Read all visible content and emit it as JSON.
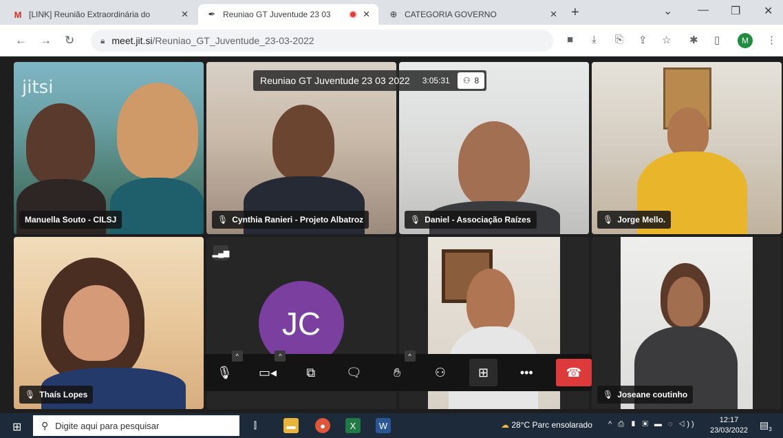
{
  "tabs": [
    {
      "title": "[LINK] Reunião Extraordinária do",
      "favicon": "gmail-icon",
      "active": false
    },
    {
      "title": "Reuniao GT Juventude 23 03",
      "favicon": "jitsi-icon",
      "active": true
    },
    {
      "title": "CATEGORIA GOVERNO",
      "favicon": "globe-icon",
      "active": false
    }
  ],
  "new_tab_symbol": "+",
  "address": {
    "host": "meet.jit.si",
    "path": "/Reuniao_GT_Juventude_23-03-2022"
  },
  "profile_initial": "M",
  "meeting": {
    "title": "Reuniao GT Juventude 23 03 2022",
    "timer": "3:05:31",
    "participant_count": "8",
    "brand": "jitsi"
  },
  "participants": [
    {
      "name": "Manuella Souto - CILSJ",
      "muted": false
    },
    {
      "name": "Cynthia Ranieri - Projeto Albatroz",
      "muted": true
    },
    {
      "name": "Daniel - Associação Raízes",
      "muted": true,
      "active_speaker": true
    },
    {
      "name": "Jorge Mello.",
      "muted": true
    },
    {
      "name": "Thaís Lopes",
      "muted": true
    },
    {
      "name": "",
      "avatar_initials": "JC",
      "avatar_color": "#7b3fa0"
    },
    {
      "name": "",
      "muted": false
    },
    {
      "name": "Joseane coutinho",
      "muted": true
    }
  ],
  "taskbar": {
    "search_placeholder": "Digite aqui para pesquisar",
    "weather": "28°C  Parc ensolarado",
    "time": "12:17",
    "date": "23/03/2022",
    "notification_count": "3"
  },
  "colors": {
    "active_border": "#3e7bd8",
    "hangup": "#dd3b3b",
    "avatar": "#7b3fa0"
  }
}
